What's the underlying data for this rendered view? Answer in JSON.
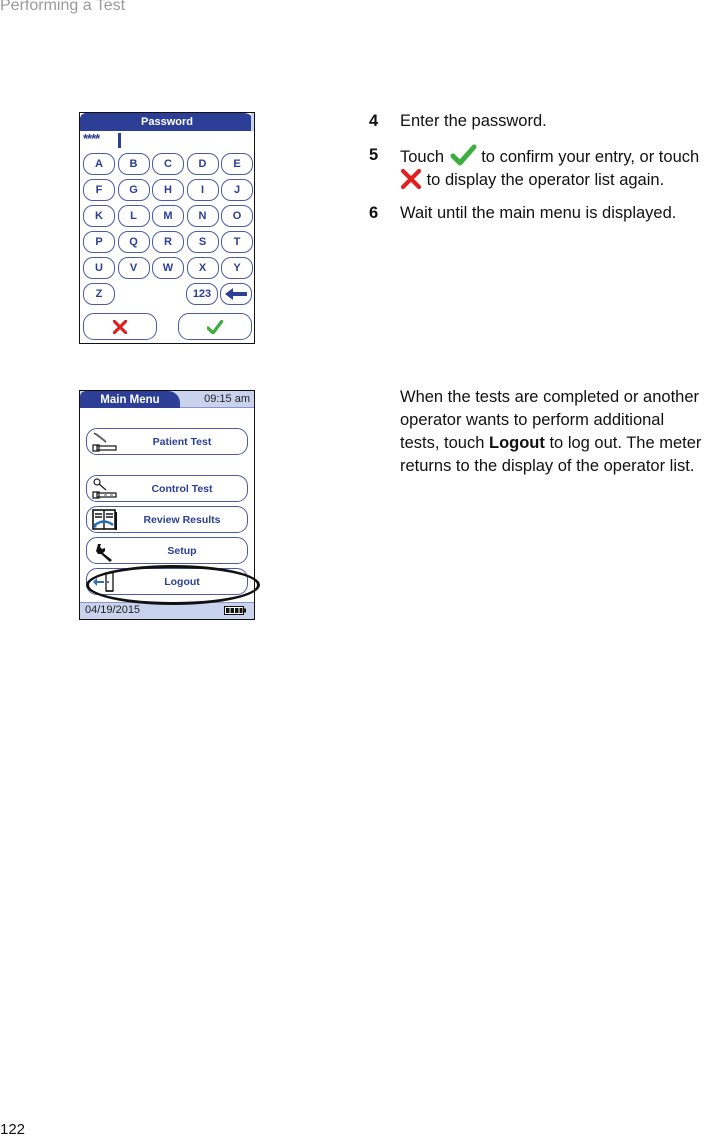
{
  "page": {
    "header": "Performing a Test",
    "page_number": "122"
  },
  "password_screen": {
    "title": "Password",
    "field_value": "****",
    "keys": [
      [
        "A",
        "B",
        "C",
        "D",
        "E"
      ],
      [
        "F",
        "G",
        "H",
        "I",
        "J"
      ],
      [
        "K",
        "L",
        "M",
        "N",
        "O"
      ],
      [
        "P",
        "Q",
        "R",
        "S",
        "T"
      ],
      [
        "U",
        "V",
        "W",
        "X",
        "Y"
      ]
    ],
    "last_row": {
      "z": "Z",
      "num": "123",
      "backspace_icon": "arrow-left-icon"
    },
    "cancel_icon": "x-icon",
    "confirm_icon": "check-icon",
    "colors": {
      "accent": "#2c3e95",
      "cancel": "#e02020",
      "confirm": "#3cae3c"
    }
  },
  "main_menu_screen": {
    "title": "Main Menu",
    "time": "09:15 am",
    "items": [
      {
        "label": "Patient Test",
        "icon": "test-strip-icon"
      },
      {
        "label": "Control Test",
        "icon": "control-strip-icon"
      },
      {
        "label": "Review Results",
        "icon": "review-book-icon"
      },
      {
        "label": "Setup",
        "icon": "wrench-icon"
      },
      {
        "label": "Logout",
        "icon": "door-exit-icon"
      }
    ],
    "date": "04/19/2015",
    "battery_level": "full"
  },
  "instructions": {
    "steps": [
      {
        "number": "4",
        "text": "Enter the password."
      },
      {
        "number": "5",
        "text_before": "Touch",
        "text_after_check": "to confirm your entry, or touch",
        "text_after_x": "to display the operator list again."
      },
      {
        "number": "6",
        "text": "Wait until the main menu is displayed."
      }
    ],
    "logout_paragraph": {
      "line1": "When the tests are completed or another",
      "line2": "operator wants to perform additional",
      "line3_before": "tests, touch",
      "line3_bold": "Logout",
      "line3_after": "to log out. The meter",
      "line4": "returns to the display of the operator list."
    }
  }
}
